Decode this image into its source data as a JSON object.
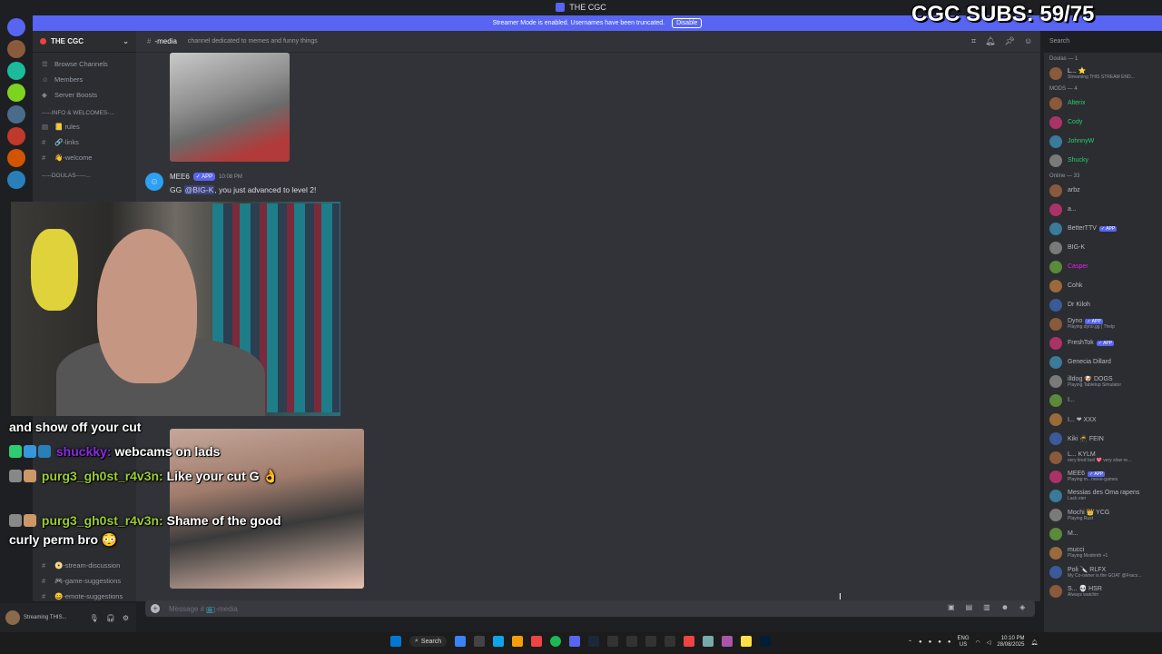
{
  "window": {
    "title": "THE CGC"
  },
  "banner": {
    "text": "Streamer Mode is enabled. Usernames have been truncated.",
    "action": "Disable"
  },
  "overlay": {
    "subs": "CGC SUBS: 59/75"
  },
  "server": {
    "name": "THE CGC"
  },
  "sidebar": {
    "items": [
      {
        "label": "Browse Channels",
        "icon": "browse-icon"
      },
      {
        "label": "Members",
        "icon": "members-icon"
      },
      {
        "label": "Server Boosts",
        "icon": "boost-icon"
      }
    ],
    "category_info": "-----INFO & WELCOMES-...",
    "channels_info": [
      {
        "label": "rules",
        "prefix": "📒"
      },
      {
        "label": "-links",
        "prefix": "🔗"
      },
      {
        "label": "-welcome",
        "prefix": "👋"
      }
    ],
    "category_doulas": "-----DOULAS-----...",
    "channels_bottom": [
      {
        "label": "-stream-discussion",
        "prefix": "📀"
      },
      {
        "label": "-game-suggestions",
        "prefix": "🎮"
      },
      {
        "label": "-emote-suggestions",
        "prefix": "😀"
      }
    ]
  },
  "header": {
    "channel": "-media",
    "topic": "channel dedicated to memes and funny things",
    "search_placeholder": "Search"
  },
  "message": {
    "author": "MEE6",
    "badge": "✓ APP",
    "time": "10:08 PM",
    "text_prefix": "GG ",
    "mention": "@BIG-K",
    "text_suffix": ", you just advanced to level 2!"
  },
  "chat_overlay": {
    "lines": [
      {
        "user": "",
        "text": "and show off your cut"
      },
      {
        "user": "shuckky:",
        "text": "webcams on lads",
        "user_color": "#8a2be2"
      },
      {
        "user": "purg3_gh0st_r4v3n:",
        "text": "Like your cut G 👌",
        "user_color": "#9acd32"
      },
      {
        "user": "purg3_gh0st_r4v3n:",
        "text": "Shame of the good",
        "user_color": "#9acd32"
      },
      {
        "user": "",
        "text": "curly perm bro 😳"
      }
    ]
  },
  "input": {
    "placeholder": "Message # 📺-media"
  },
  "members": {
    "doulas_header": "Doulas — 1",
    "doulas": [
      {
        "name": "L... ⭐",
        "sub": "Streaming THIS STREAM END...",
        "color": "#f2f3f5"
      }
    ],
    "mods_header": "MODS — 4",
    "mods": [
      {
        "name": "Alterix",
        "color": "#2ecc71"
      },
      {
        "name": "Cody",
        "color": "#2ecc71"
      },
      {
        "name": "JohnnyW",
        "color": "#2ecc71"
      },
      {
        "name": "Shucky",
        "color": "#2ecc71"
      }
    ],
    "online_header": "Online — 33",
    "online": [
      {
        "name": "arbz",
        "color": "#b5bac1"
      },
      {
        "name": "a...",
        "color": "#b5bac1"
      },
      {
        "name": "BetterTTV",
        "color": "#b5bac1",
        "badge": "✓ APP"
      },
      {
        "name": "BIG-K",
        "color": "#b5bac1"
      },
      {
        "name": "Casper",
        "color": "#e91ef7"
      },
      {
        "name": "Cohk",
        "color": "#b5bac1"
      },
      {
        "name": "Dr Kiloh",
        "color": "#b5bac1"
      },
      {
        "name": "Dyno",
        "color": "#b5bac1",
        "badge": "✓ APP",
        "sub": "Playing dyno.gg | ?help"
      },
      {
        "name": "FreshTok",
        "color": "#b5bac1",
        "badge": "✓ APP"
      },
      {
        "name": "Genecia Dillard",
        "color": "#b5bac1"
      },
      {
        "name": "illdog 🐶 DOGS",
        "color": "#b5bac1",
        "sub": "Playing Tabletop Simulator"
      },
      {
        "name": "I...",
        "color": "#b5bac1"
      },
      {
        "name": "I... ❤ XXX",
        "color": "#b5bac1"
      },
      {
        "name": "Kiki 🥷 FEIN",
        "color": "#b5bac1"
      },
      {
        "name": "L... KYLM",
        "color": "#b5bac1",
        "sub": "very tired borl 💖 very slow re..."
      },
      {
        "name": "MEE6",
        "color": "#b5bac1",
        "badge": "✓ APP",
        "sub": "Playing m...meee-games"
      },
      {
        "name": "Messias des Oma rapens",
        "color": "#b5bac1",
        "sub": "Lack eier"
      },
      {
        "name": "Mochi 👑 YCG",
        "color": "#b5bac1",
        "sub": "Playing Rust"
      },
      {
        "name": "M...",
        "color": "#b5bac1"
      },
      {
        "name": "mucci",
        "color": "#b5bac1",
        "sub": "Playing Modrinth +1"
      },
      {
        "name": "Poli 🔪 RLFX",
        "color": "#b5bac1",
        "sub": "My Co-owner is the GOAT @Fracs..."
      },
      {
        "name": "S... 💀 HSR",
        "color": "#b5bac1",
        "sub": "Always watchin"
      }
    ]
  },
  "usercard": {
    "status": "Streaming THIS..."
  },
  "taskbar": {
    "search": "Search",
    "lang1": "ENG",
    "lang2": "US",
    "time": "10:10 PM",
    "date": "28/08/2025"
  }
}
